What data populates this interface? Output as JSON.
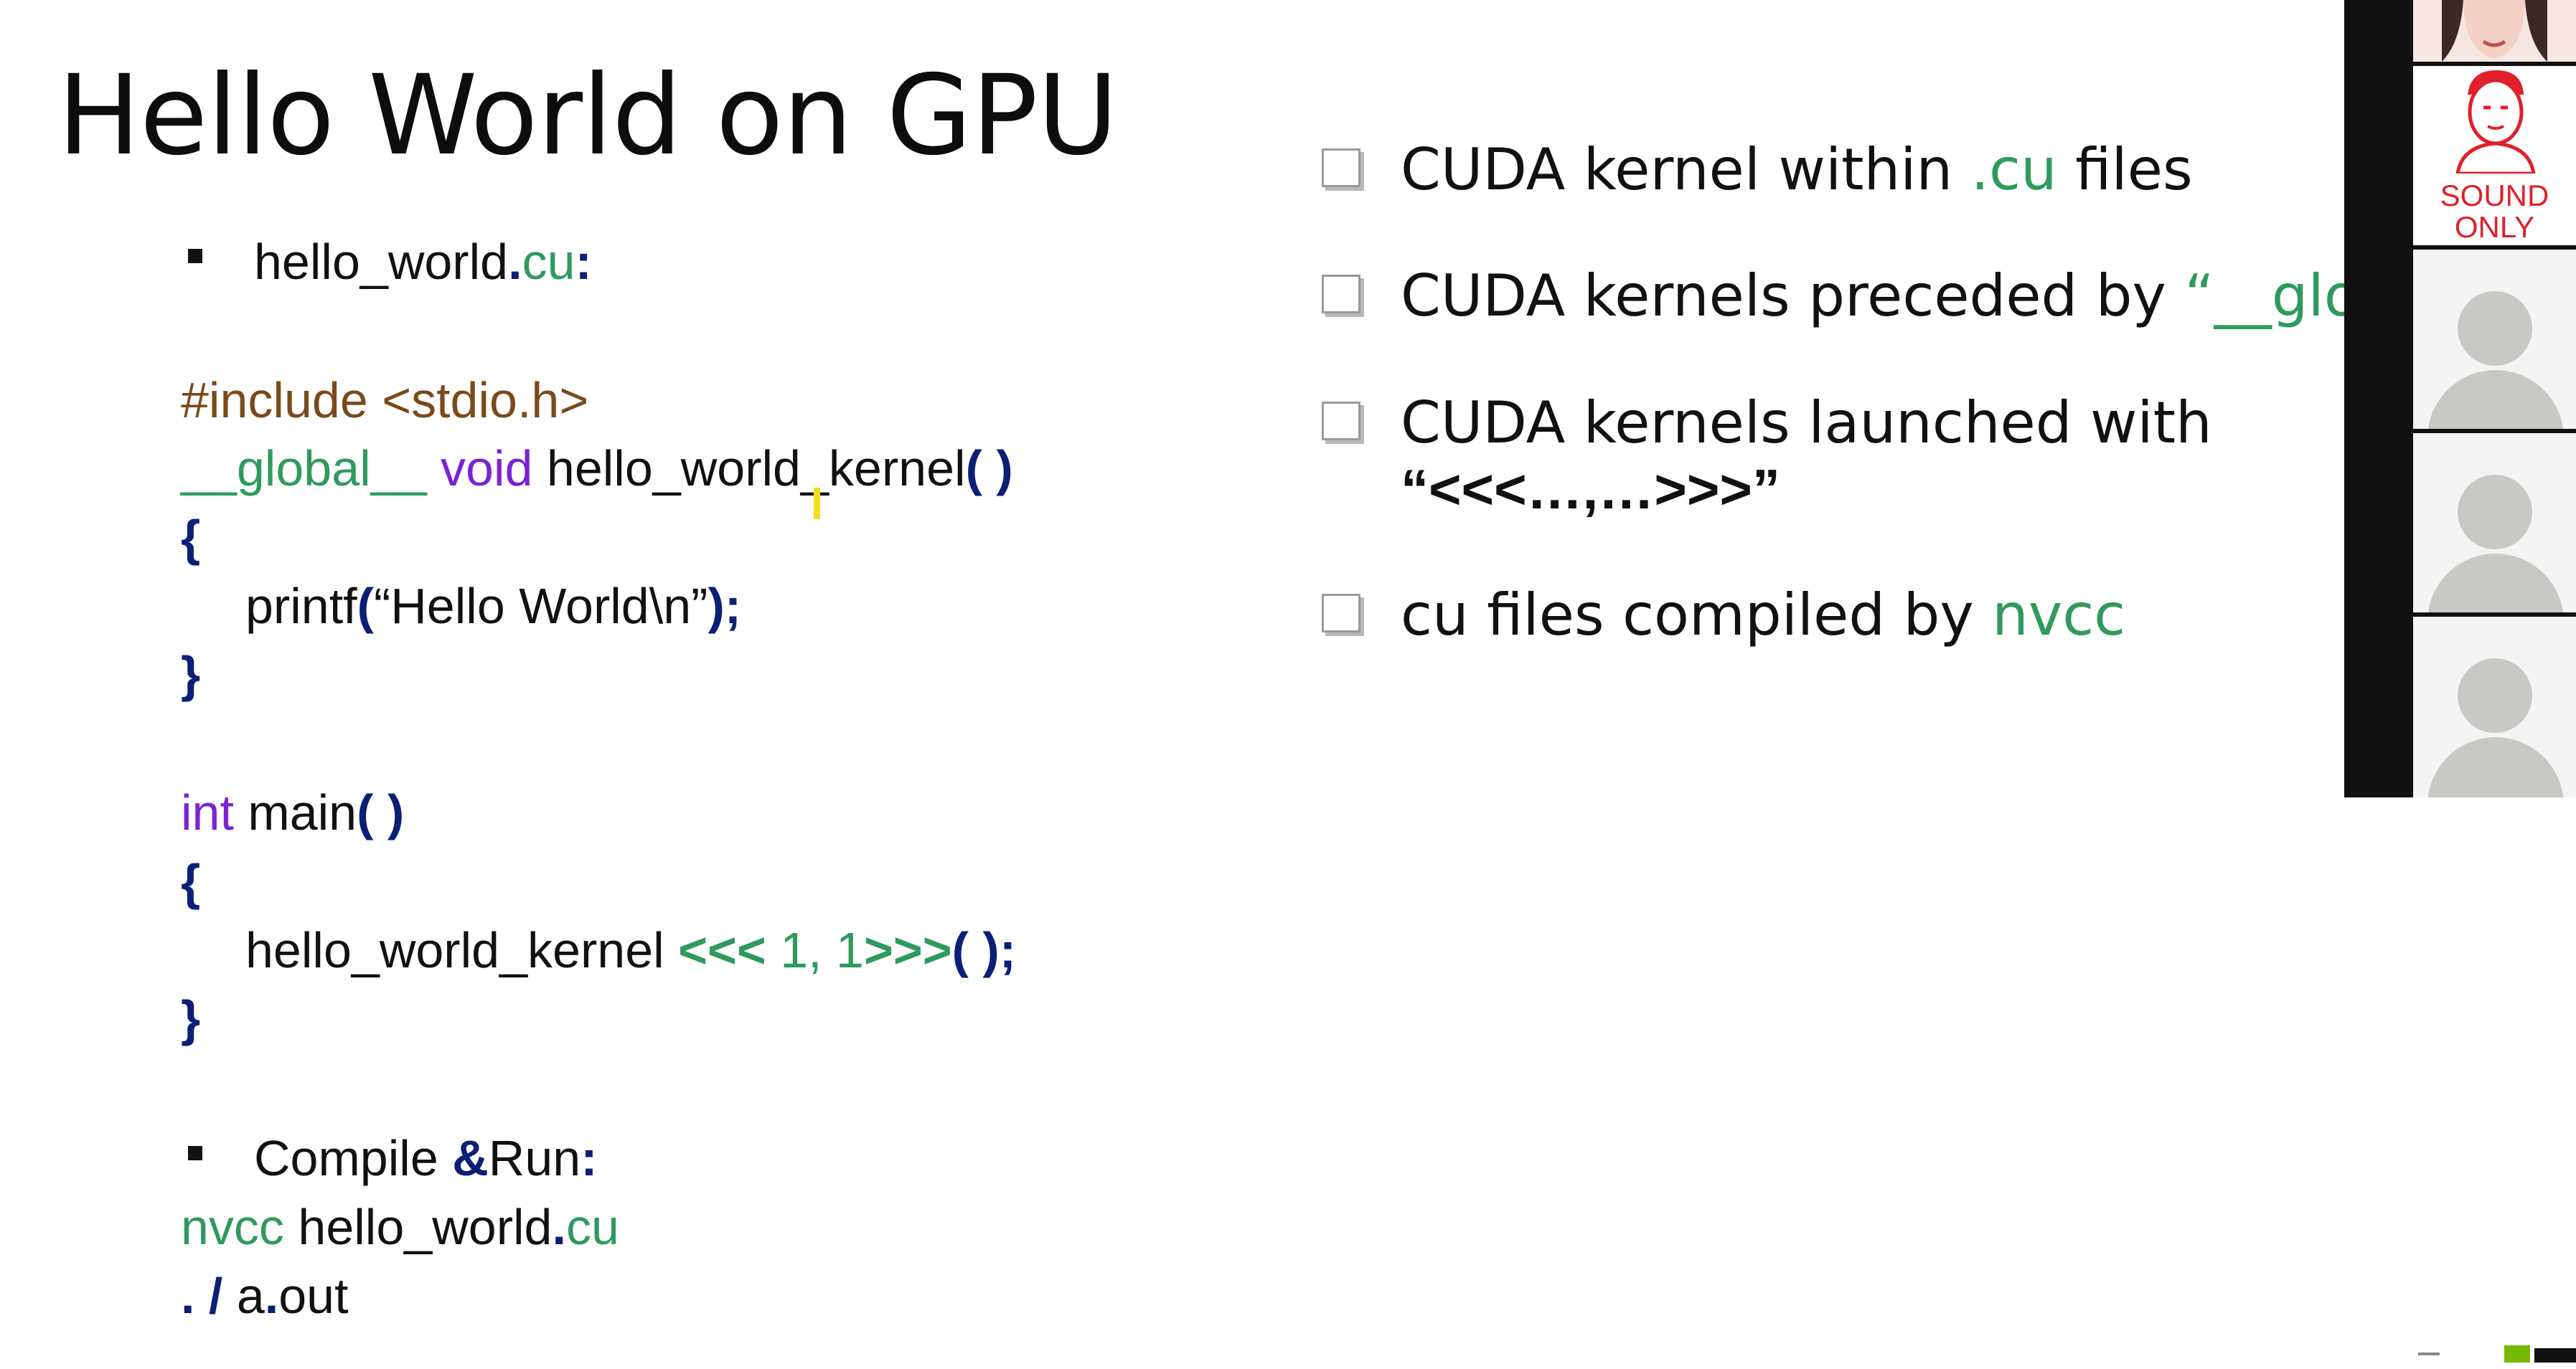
{
  "slide": {
    "title": "Hello World on GPU",
    "left": {
      "bullet1": {
        "text": "hello_world",
        "dot": ".",
        "ext": "cu",
        "colon": ":"
      },
      "code": {
        "include": "#include <stdio.h>",
        "global_kw": "__global__",
        "void_kw": "void",
        "kernel_name": "hello_world_kernel",
        "empty_parens": "( )",
        "open_brace": "{",
        "printf_fn": "printf",
        "paren_open": "(",
        "string_literal": "“Hello World\\n”",
        "paren_close_semi": ");",
        "close_brace": "}",
        "int_kw": "int",
        "main_fn": "main",
        "kernel_call_name": "hello_world_kernel",
        "launch_open": "<<<",
        "launch_args": "1, 1",
        "launch_close": ">>>",
        "call_parens_semi": "( );"
      },
      "bullet2": {
        "text_before": "Compile ",
        "amp": "&",
        "text_after": "Run",
        "colon": ":"
      },
      "commands": {
        "nvcc": "nvcc",
        "file": "hello_world",
        "dot": ".",
        "ext": "cu",
        "run_dot": ".",
        "run_slash": "/",
        "run_a": "a",
        "run_dot2": ".",
        "run_out": "out"
      }
    },
    "right": {
      "items": [
        {
          "pre": "CUDA kernel within ",
          "hl": ".cu",
          "post": " files"
        },
        {
          "pre": "CUDA kernels preceded by ",
          "hl": "“__glo",
          "post": ""
        },
        {
          "pre": "CUDA kernels launched with",
          "hl": "“<<<…,…>>>”",
          "post": ""
        },
        {
          "pre": "cu files compiled by ",
          "hl": "nvcc",
          "post": ""
        }
      ]
    }
  },
  "video": {
    "sound_only_line1": "SOUND",
    "sound_only_line2": "ONLY"
  },
  "colors": {
    "code_green": "#2f9a5d",
    "code_purple": "#7b22d4",
    "code_brown": "#7a4a1a",
    "code_navy": "#0c1f76"
  }
}
